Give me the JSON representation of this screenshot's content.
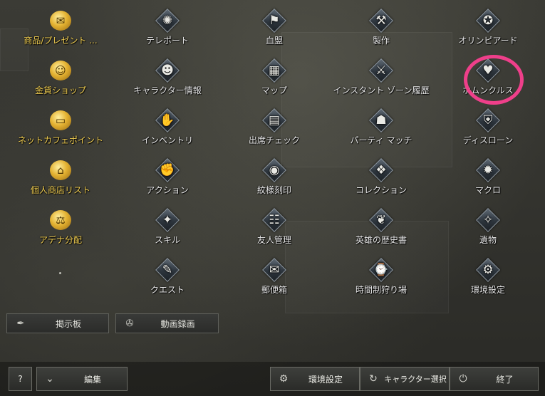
{
  "menu": {
    "items": [
      {
        "label": "商品/プレゼント ...",
        "icon": "gift-icon",
        "glyph": "✉",
        "gold": true
      },
      {
        "label": "テレポート",
        "icon": "teleport-swirl-icon",
        "glyph": "✺",
        "gold": false
      },
      {
        "label": "血盟",
        "icon": "clan-banner-icon",
        "glyph": "⚑",
        "gold": false
      },
      {
        "label": "製作",
        "icon": "crafting-hammers-icon",
        "glyph": "⚒",
        "gold": false
      },
      {
        "label": "オリンピアード",
        "icon": "olympiad-crest-icon",
        "glyph": "✪",
        "gold": false
      },
      {
        "label": "金貨ショップ",
        "icon": "gold-coin-shop-icon",
        "glyph": "☺",
        "gold": true
      },
      {
        "label": "キャラクター情報",
        "icon": "character-info-icon",
        "glyph": "☻",
        "gold": false
      },
      {
        "label": "マップ",
        "icon": "map-icon",
        "glyph": "▦",
        "gold": false
      },
      {
        "label": "インスタント ゾーン履歴",
        "icon": "instant-zone-swords-icon",
        "glyph": "⚔",
        "gold": false
      },
      {
        "label": "ホムンクルス",
        "icon": "homunculus-heart-icon",
        "glyph": "♥",
        "gold": false
      },
      {
        "label": "ネットカフェポイント",
        "icon": "netcafe-monitor-icon",
        "glyph": "▭",
        "gold": true
      },
      {
        "label": "インベントリ",
        "icon": "inventory-bag-icon",
        "glyph": "✋",
        "gold": false
      },
      {
        "label": "出席チェック",
        "icon": "attendance-calendar-icon",
        "glyph": "▤",
        "gold": false
      },
      {
        "label": "パーティ マッチ",
        "icon": "party-match-icon",
        "glyph": "☗",
        "gold": false
      },
      {
        "label": "ディスローン",
        "icon": "dethrone-shield-icon",
        "glyph": "⛨",
        "gold": false
      },
      {
        "label": "個人商店リスト",
        "icon": "private-store-icon",
        "glyph": "⌂",
        "gold": true
      },
      {
        "label": "アクション",
        "icon": "action-fist-icon",
        "glyph": "✊",
        "gold": false
      },
      {
        "label": "紋様刻印",
        "icon": "dye-pattern-icon",
        "glyph": "◉",
        "gold": false
      },
      {
        "label": "コレクション",
        "icon": "collection-icon",
        "glyph": "❖",
        "gold": false
      },
      {
        "label": "マクロ",
        "icon": "macro-gear-icon",
        "glyph": "✹",
        "gold": false
      },
      {
        "label": "アデナ分配",
        "icon": "adena-scale-icon",
        "glyph": "⚖",
        "gold": true
      },
      {
        "label": "スキル",
        "icon": "skill-book-icon",
        "glyph": "✦",
        "gold": false
      },
      {
        "label": "友人管理",
        "icon": "friends-icon",
        "glyph": "☷",
        "gold": false
      },
      {
        "label": "英雄の歴史書",
        "icon": "hero-history-book-icon",
        "glyph": "❦",
        "gold": false
      },
      {
        "label": "遺物",
        "icon": "relic-icon",
        "glyph": "✧",
        "gold": false
      },
      {
        "label": "",
        "icon": "empty-slot-dot-icon",
        "glyph": "",
        "gold": false
      },
      {
        "label": "クエスト",
        "icon": "quest-scroll-icon",
        "glyph": "✎",
        "gold": false
      },
      {
        "label": "郵便箱",
        "icon": "mailbox-envelope-icon",
        "glyph": "✉",
        "gold": false
      },
      {
        "label": "時間制狩り場",
        "icon": "timed-hunting-zone-icon",
        "glyph": "⌚",
        "gold": false
      },
      {
        "label": "環境設定",
        "icon": "settings-icon",
        "glyph": "⚙",
        "gold": false
      }
    ]
  },
  "shortcuts": {
    "board_label": "掲示板",
    "board_icon": "quill-icon",
    "recording_label": "動画録画",
    "recording_icon": "film-reel-icon"
  },
  "footer": {
    "help_label": "?",
    "edit_label": "編集",
    "settings_label": "環境設定",
    "char_select_label": "キャラクター選択",
    "exit_label": "終了"
  },
  "colors": {
    "highlight_ring": "#ef3f8a",
    "gold_label": "#f2cf52"
  }
}
